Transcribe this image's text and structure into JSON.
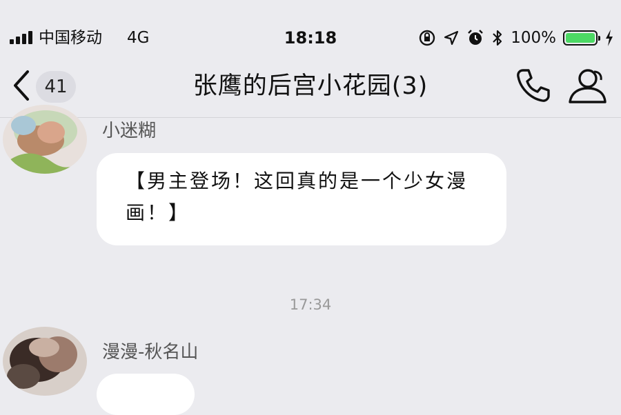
{
  "status_bar": {
    "carrier": "中国移动",
    "network": "4G",
    "time": "18:18",
    "battery_percent": "100%",
    "battery_level": 1.0,
    "icons": [
      "signal-icon",
      "orientation-lock-icon",
      "location-icon",
      "alarm-icon",
      "bluetooth-icon",
      "battery-icon",
      "charging-icon"
    ]
  },
  "nav": {
    "back_icon": "chevron-left-icon",
    "unread_count": "41",
    "title": "张鹰的后宫小花园(3)",
    "phone_icon": "phone-icon",
    "contact_icon": "group-members-icon"
  },
  "messages": [
    {
      "sender": "小迷糊",
      "text": "【男主登场！这回真的是一个少女漫画！】"
    },
    {
      "sender": "漫漫-秋名山",
      "text": ""
    }
  ],
  "timestamp": "17:34",
  "colors": {
    "background": "#ebebef",
    "bubble": "#ffffff",
    "battery": "#4cd964"
  }
}
